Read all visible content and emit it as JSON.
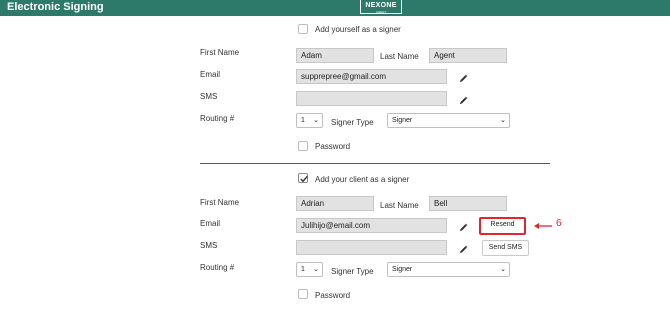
{
  "header": {
    "title": "Electronic Signing",
    "logo_line1": "NEXONE",
    "logo_line2": "AGENT",
    "background": "#2d7a6b"
  },
  "agent_section": {
    "add_signer_label": "Add yourself as a signer",
    "add_signer_checked": false,
    "first_name_label": "First Name",
    "first_name_value": "Adam",
    "last_name_label": "Last Name",
    "last_name_value": "Agent",
    "email_label": "Email",
    "email_value": "supprepree@gmail.com",
    "sms_label": "SMS",
    "sms_value": "",
    "routing_label": "Routing #",
    "routing_value": "1",
    "signer_type_label": "Signer Type",
    "signer_type_value": "Signer",
    "password_label": "Password",
    "password_checked": false
  },
  "client_section": {
    "add_signer_label": "Add your client as a signer",
    "add_signer_checked": true,
    "first_name_label": "First Name",
    "first_name_value": "Adrian",
    "last_name_label": "Last Name",
    "last_name_value": "Bell",
    "email_label": "Email",
    "email_value": "Julihijo@email.com",
    "sms_label": "SMS",
    "sms_value": "",
    "resend_label": "Resend",
    "send_sms_label": "Send SMS",
    "routing_label": "Routing #",
    "routing_value": "1",
    "signer_type_label": "Signer Type",
    "signer_type_value": "Signer",
    "password_label": "Password",
    "password_checked": false
  },
  "annotation": {
    "number": "6",
    "color": "#e0262e"
  },
  "icons": {
    "edit": "pencil-icon",
    "check": "check-icon",
    "dropdown": "chevron-down-icon",
    "arrow": "arrow-left-icon"
  }
}
